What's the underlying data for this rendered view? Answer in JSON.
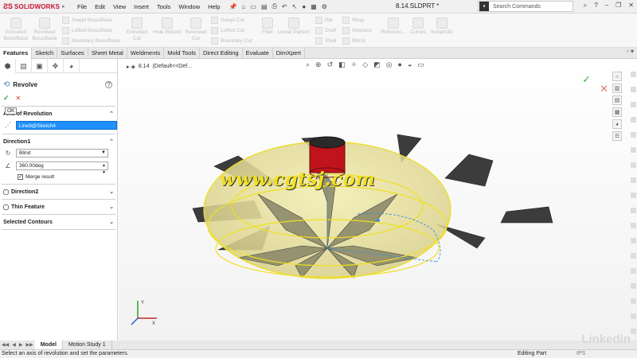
{
  "app": {
    "logo": "SOLIDWORKS",
    "doc_title": "8.14.SLDPRT *"
  },
  "menu": [
    "File",
    "Edit",
    "View",
    "Insert",
    "Tools",
    "Window",
    "Help"
  ],
  "search": {
    "placeholder": "Search Commands"
  },
  "ribbon": {
    "extruded_boss": "Extruded\nBoss/Base",
    "revolved_boss": "Revolved\nBoss/Base",
    "swept_boss": "Swept Boss/Base",
    "lofted_boss": "Lofted Boss/Base",
    "boundary_boss": "Boundary Boss/Base",
    "extruded_cut": "Extruded\nCut",
    "hole_wizard": "Hole Wizard",
    "revolved_cut": "Revolved\nCut",
    "swept_cut": "Swept Cut",
    "lofted_cut": "Lofted Cut",
    "boundary_cut": "Boundary Cut",
    "fillet": "Fillet",
    "linear_pattern": "Linear Pattern",
    "rib": "Rib",
    "draft": "Draft",
    "shell": "Shell",
    "wrap": "Wrap",
    "intersect": "Intersect",
    "mirror": "Mirror",
    "reference": "Referenc...",
    "curves": "Curves",
    "instant3d": "Instant3D"
  },
  "tabs": [
    "Features",
    "Sketch",
    "Surfaces",
    "Sheet Metal",
    "Weldments",
    "Mold Tools",
    "Direct Editing",
    "Evaluate",
    "DimXpert"
  ],
  "property_manager": {
    "title": "Revolve",
    "ok_tooltip": "OK",
    "axis_section": "Axis of Revolution",
    "axis_value": "Line9@Sketch4",
    "direction1": "Direction1",
    "end_condition": "Blind",
    "angle": "360.00deg",
    "merge_result": "Merge result",
    "direction2": "Direction2",
    "thin_feature": "Thin Feature",
    "selected_contours": "Selected Contours"
  },
  "graphics": {
    "tree_item": "8.14",
    "tree_config": "(Default<<Def...",
    "watermark": "www.cgtsj.com"
  },
  "bottom_tabs": [
    "Model",
    "Motion Study 1"
  ],
  "status": {
    "message": "Select an axis of revolution and set the parameters.",
    "mode": "Editing Part",
    "units": "IPS"
  },
  "brand_watermark": "Linkedin",
  "colors": {
    "accent": "#1e90ff",
    "logo": "#c8102e",
    "ok_green": "#3a9d3a",
    "cancel_red": "#c0392b",
    "preview_yellow": "#e8e080"
  }
}
